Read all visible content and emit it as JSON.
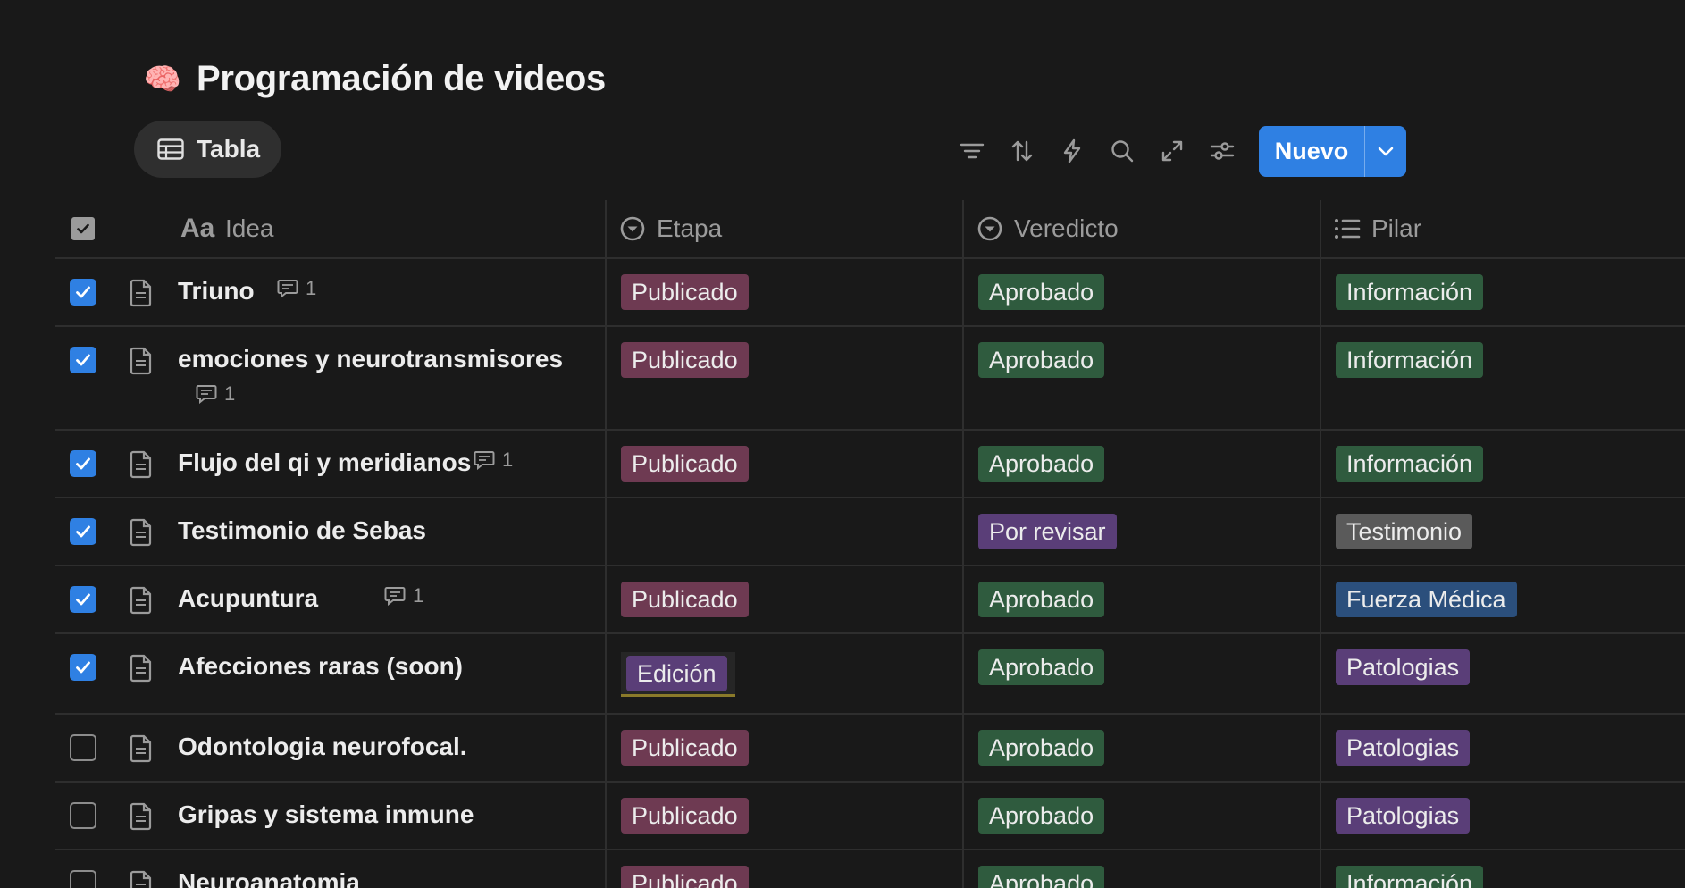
{
  "page": {
    "emoji": "🧠",
    "title": "Programación de videos"
  },
  "view": {
    "label": "Tabla"
  },
  "toolbar": {
    "icons": [
      "filter-icon",
      "sort-icon",
      "automation-bolt-icon",
      "search-icon",
      "expand-icon",
      "settings-sliders-icon"
    ],
    "new_label": "Nuevo"
  },
  "columns": {
    "idea": "Idea",
    "etapa": "Etapa",
    "veredicto": "Veredicto",
    "pilar": "Pilar"
  },
  "rows": [
    {
      "checked": true,
      "idea": "Triuno",
      "comments": "1",
      "etapa": "Publicado",
      "veredicto": "Aprobado",
      "pilar": "Información"
    },
    {
      "checked": true,
      "idea": "emociones y neurotransmisores",
      "comments": "1",
      "etapa": "Publicado",
      "veredicto": "Aprobado",
      "pilar": "Información"
    },
    {
      "checked": true,
      "idea": "Flujo del qi y meridianos",
      "comments": "1",
      "etapa": "Publicado",
      "veredicto": "Aprobado",
      "pilar": "Información"
    },
    {
      "checked": true,
      "idea": "Testimonio de Sebas",
      "comments": "",
      "etapa": "",
      "veredicto": "Por revisar",
      "pilar": "Testimonio"
    },
    {
      "checked": true,
      "idea": "Acupuntura",
      "comments": "1",
      "etapa": "Publicado",
      "veredicto": "Aprobado",
      "pilar": "Fuerza Médica"
    },
    {
      "checked": true,
      "idea": "Afecciones raras (soon)",
      "comments": "",
      "etapa": "Edición",
      "veredicto": "Aprobado",
      "pilar": "Patologias"
    },
    {
      "checked": false,
      "idea": "Odontologia neurofocal.",
      "comments": "",
      "etapa": "Publicado",
      "veredicto": "Aprobado",
      "pilar": "Patologias"
    },
    {
      "checked": false,
      "idea": "Gripas y sistema inmune",
      "comments": "",
      "etapa": "Publicado",
      "veredicto": "Aprobado",
      "pilar": "Patologias"
    },
    {
      "checked": false,
      "idea": "Neuroanatomia",
      "comments": "",
      "etapa": "Publicado",
      "veredicto": "Aprobado",
      "pilar": "Información"
    }
  ],
  "colors": {
    "background": "#191919",
    "accent": "#2f80e3",
    "tag_publicado": "#6e3a52",
    "tag_aprobado": "#2f5b3e",
    "tag_purple": "#5a3e78",
    "tag_gray": "#5a5a5a",
    "tag_blue": "#2b4f7c"
  }
}
